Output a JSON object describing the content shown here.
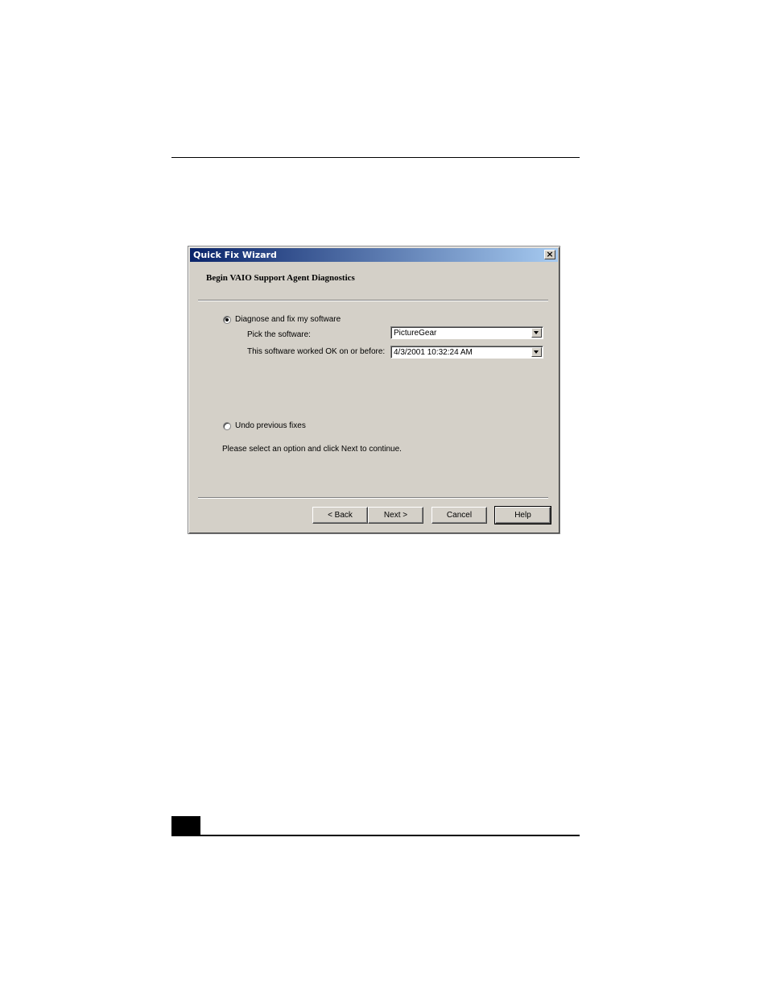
{
  "dialog": {
    "title": "Quick Fix Wizard",
    "close_label": "×",
    "heading": "Begin VAIO Support Agent Diagnostics",
    "option_diagnose": {
      "label": "Diagnose and fix my software",
      "selected": true
    },
    "pick_label": "Pick the software:",
    "pick_value": "PictureGear",
    "worked_label": "This software worked OK on or before:",
    "worked_value": "4/3/2001 10:32:24 AM",
    "option_undo": {
      "label": "Undo previous fixes",
      "selected": false
    },
    "instruction": "Please select an option  and click Next to continue.",
    "buttons": {
      "back": "< Back",
      "next": "Next >",
      "cancel": "Cancel",
      "help": "Help"
    }
  }
}
